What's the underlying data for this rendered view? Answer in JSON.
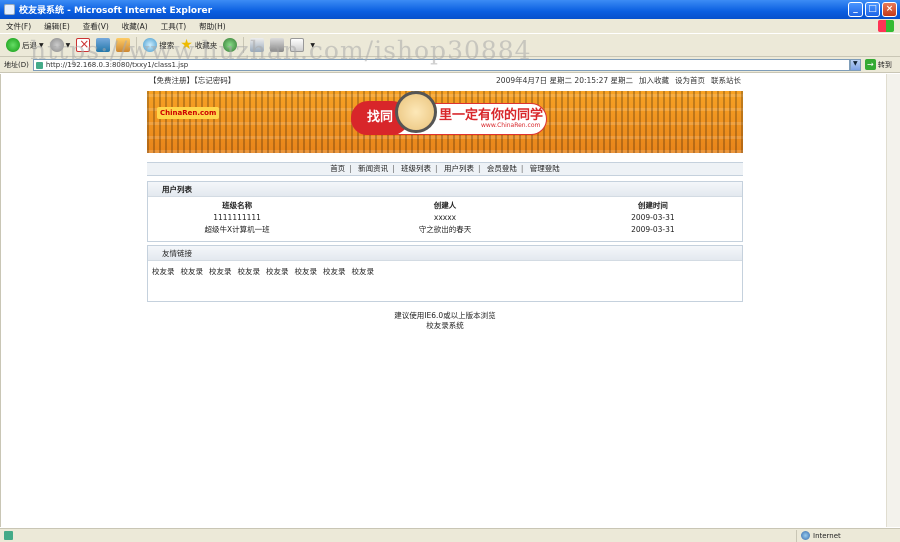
{
  "window": {
    "title": "校友录系统 - Microsoft Internet Explorer"
  },
  "menu": [
    "文件(F)",
    "编辑(E)",
    "查看(V)",
    "收藏(A)",
    "工具(T)",
    "帮助(H)"
  ],
  "toolbar": {
    "back": "后退",
    "search": "搜索",
    "favorites": "收藏夹"
  },
  "address": {
    "label": "地址(D)",
    "url": "http://192.168.0.3:8080/txxy1/class1.jsp",
    "go": "转到"
  },
  "topinfo": {
    "left": "【免费注册】【忘记密码】",
    "datetime": "2009年4月7日 星期二 20:15:27  星期二",
    "links": [
      "加入收藏",
      "设为首页",
      "联系站长"
    ]
  },
  "banner": {
    "logo": "ChinaRen.com",
    "find": "找同",
    "slogan": "里一定有你的同学",
    "url": "www.ChinaRen.com"
  },
  "nav": [
    "首页",
    "新闻资讯",
    "班级列表",
    "用户列表",
    "会员登陆",
    "管理登陆"
  ],
  "users": {
    "title": "用户列表",
    "headers": [
      "班级名称",
      "创建人",
      "创建时间"
    ],
    "rows": [
      [
        "1111111111",
        "xxxxx",
        "2009-03-31"
      ],
      [
        "超级牛X计算机一班",
        "守之欲出的春天",
        "2009-03-31"
      ]
    ]
  },
  "links": {
    "title": "友情链接",
    "items": [
      "校友录",
      "校友录",
      "校友录",
      "校友录",
      "校友录",
      "校友录",
      "校友录",
      "校友录"
    ]
  },
  "footer": {
    "line1": "建议使用IE6.0或以上版本浏览",
    "line2": "校友录系统"
  },
  "status": {
    "zone": "Internet"
  },
  "watermark": "https://www.huzhan.com/ishop30884"
}
